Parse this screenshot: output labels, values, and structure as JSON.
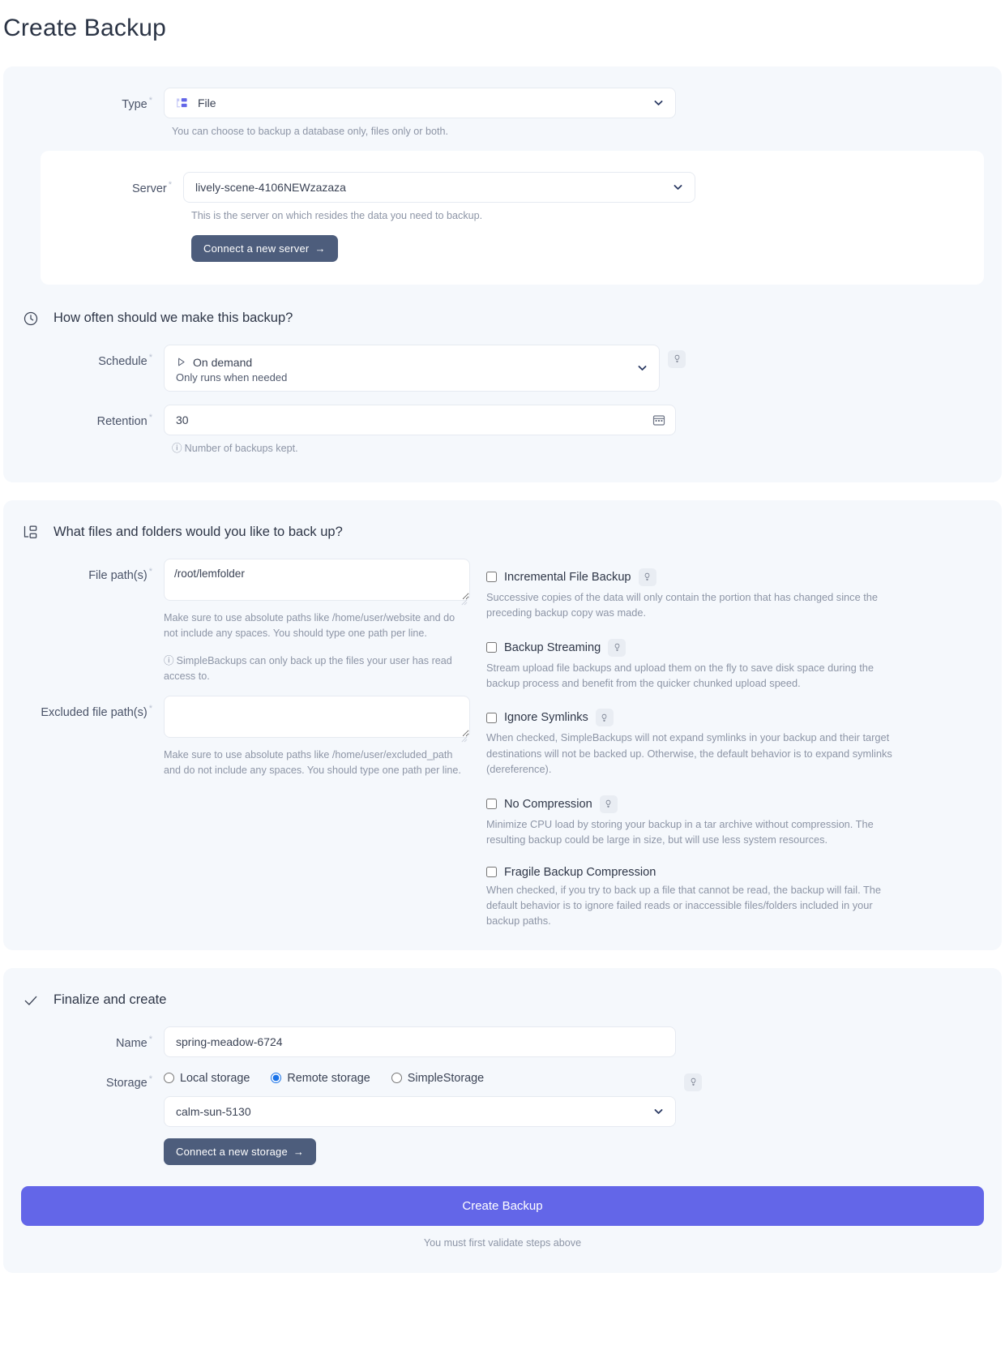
{
  "page": {
    "title": "Create Backup"
  },
  "type_section": {
    "label": "Type",
    "required_mark": "*",
    "value": "File",
    "icon": "file-tree-icon",
    "helper": "You can choose to backup a database only, files only or both."
  },
  "server_section": {
    "label": "Server",
    "required_mark": "*",
    "value": "lively-scene-4106NEWzazaza",
    "helper": "This is the server on which resides the data you need to backup.",
    "connect_button": "Connect a new server",
    "connect_button_arrow": "→"
  },
  "schedule_section": {
    "heading": "How often should we make this backup?",
    "heading_icon": "clock-icon",
    "schedule": {
      "label": "Schedule",
      "required_mark": "*",
      "value": "On demand",
      "sub_value": "Only runs when needed",
      "value_icon": "play-icon",
      "tooltip_icon": "lightbulb-icon"
    },
    "retention": {
      "label": "Retention",
      "required_mark": "*",
      "value": "30",
      "helper": "Number of backups kept.",
      "helper_icon": "info-icon",
      "field_icon": "calendar-icon"
    }
  },
  "files_section": {
    "heading": "What files and folders would you like to back up?",
    "heading_icon": "folder-tree-icon",
    "file_paths": {
      "label": "File path(s)",
      "required_mark": "*",
      "value": "/root/lemfolder",
      "placeholder": "",
      "helper": "Make sure to use absolute paths like /home/user/website and do not include any spaces. You should type one path per line.",
      "note": "SimpleBackups can only back up the files your user has read access to.",
      "note_icon": "info-icon"
    },
    "excluded_paths": {
      "label": "Excluded file path(s)",
      "required_mark": "*",
      "value": "",
      "placeholder": "",
      "helper": "Make sure to use absolute paths like /home/user/excluded_path and do not include any spaces. You should type one path per line."
    },
    "options": [
      {
        "label": "Incremental File Backup",
        "checked": false,
        "tooltip_icon": "lightbulb-icon",
        "has_tooltip": true,
        "description": "Successive copies of the data will only contain the portion that has changed since the preceding backup copy was made."
      },
      {
        "label": "Backup Streaming",
        "checked": false,
        "tooltip_icon": "lightbulb-icon",
        "has_tooltip": true,
        "description": "Stream upload file backups and upload them on the fly to save disk space during the backup process and benefit from the quicker chunked upload speed."
      },
      {
        "label": "Ignore Symlinks",
        "checked": false,
        "tooltip_icon": "lightbulb-icon",
        "has_tooltip": true,
        "description": "When checked, SimpleBackups will not expand symlinks in your backup and their target destinations will not be backed up. Otherwise, the default behavior is to expand symlinks (dereference)."
      },
      {
        "label": "No Compression",
        "checked": false,
        "tooltip_icon": "lightbulb-icon",
        "has_tooltip": true,
        "description": "Minimize CPU load by storing your backup in a tar archive without compression. The resulting backup could be large in size, but will use less system resources."
      },
      {
        "label": "Fragile Backup Compression",
        "checked": false,
        "tooltip_icon": "",
        "has_tooltip": false,
        "description": "When checked, if you try to back up a file that cannot be read, the backup will fail. The default behavior is to ignore failed reads or inaccessible files/folders included in your backup paths."
      }
    ]
  },
  "finalize_section": {
    "heading": "Finalize and create",
    "heading_icon": "check-icon",
    "name": {
      "label": "Name",
      "required_mark": "*",
      "value": "spring-meadow-6724"
    },
    "storage": {
      "label": "Storage",
      "required_mark": "*",
      "tooltip_icon": "lightbulb-icon",
      "options": [
        {
          "label": "Local storage",
          "selected": false
        },
        {
          "label": "Remote storage",
          "selected": true
        },
        {
          "label": "SimpleStorage",
          "selected": false
        }
      ],
      "selected_storage": "calm-sun-5130",
      "connect_button": "Connect a new storage",
      "connect_button_arrow": "→"
    },
    "submit_button": "Create Backup",
    "submit_note": "You must first validate steps above"
  },
  "colors": {
    "accent": "#6366e8",
    "card_bg": "#f5f8fc",
    "dark_button": "#4d5d7c",
    "radio_selected": "#1a73e8",
    "muted_text": "#8d95a6"
  }
}
